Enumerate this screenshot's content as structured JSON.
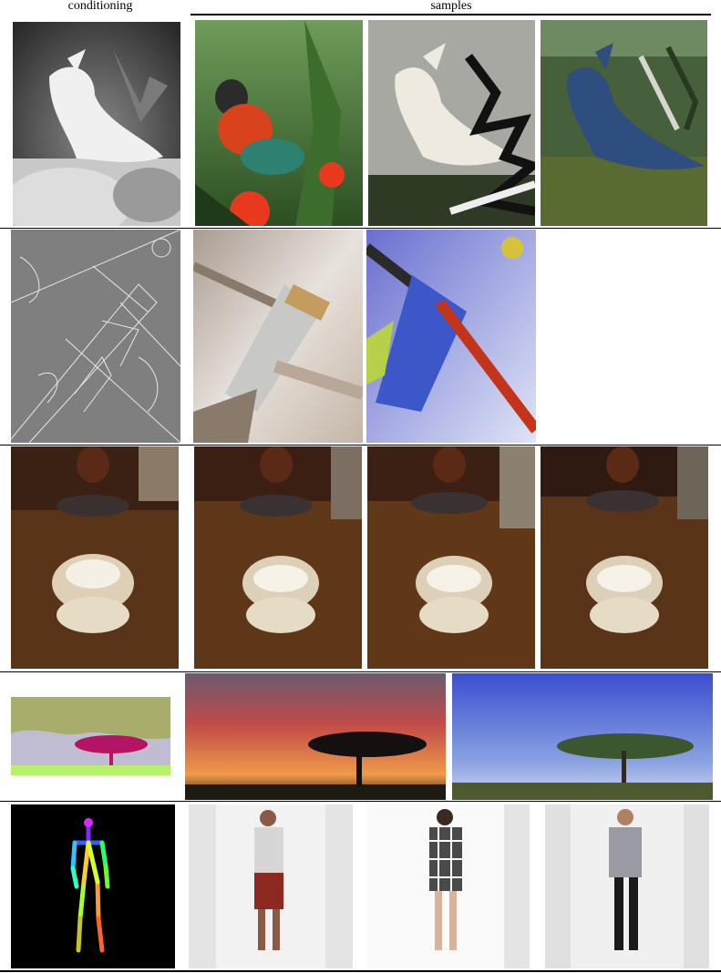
{
  "figure": {
    "header": {
      "conditioning": "conditioning",
      "samples": "samples"
    },
    "rows": [
      {
        "condition": "depth map (cockatoo)",
        "samples": [
          "colorful parrot in red flowers",
          "white cockatoo",
          "blue cockatoo"
        ]
      },
      {
        "condition": "edge map (brush)",
        "samples": [
          "paint brush close-up",
          "blue paint brush"
        ]
      },
      {
        "condition": "low-resolution (lamp)",
        "samples": [
          "lamp reflection sample 1",
          "lamp reflection sample 2",
          "lamp reflection sample 3"
        ]
      },
      {
        "condition": "semantic map (tree)",
        "samples": [
          "acacia tree at sunset",
          "acacia tree under blue sky"
        ]
      },
      {
        "condition": "pose skeleton",
        "samples": [
          "man in white tank top",
          "woman in plaid dress",
          "man in grey t-shirt"
        ]
      }
    ]
  }
}
